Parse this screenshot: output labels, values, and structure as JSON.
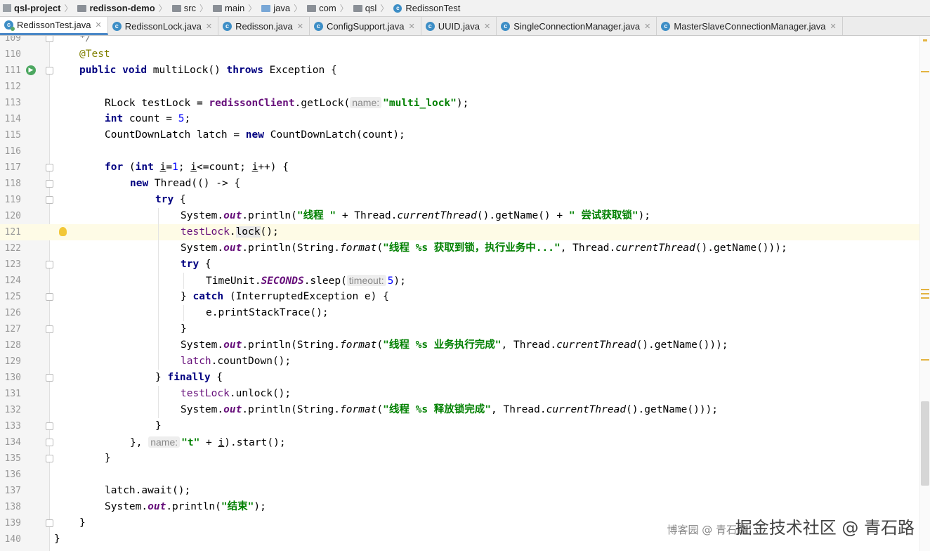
{
  "breadcrumb": {
    "items": [
      "qsl-project",
      "redisson-demo",
      "src",
      "main",
      "java",
      "com",
      "qsl",
      "RedissonTest"
    ]
  },
  "tabs": [
    {
      "label": "RedissonTest.java",
      "icon": "test-class-icon"
    },
    {
      "label": "RedissonLock.java",
      "icon": "class-icon"
    },
    {
      "label": "Redisson.java",
      "icon": "class-icon"
    },
    {
      "label": "ConfigSupport.java",
      "icon": "class-icon"
    },
    {
      "label": "UUID.java",
      "icon": "class-icon"
    },
    {
      "label": "SingleConnectionManager.java",
      "icon": "class-icon"
    },
    {
      "label": "MasterSlaveConnectionManager.java",
      "icon": "class-icon"
    }
  ],
  "editor": {
    "current_line": 121,
    "line_numbers": [
      "109",
      "110",
      "111",
      "112",
      "113",
      "114",
      "115",
      "116",
      "117",
      "118",
      "119",
      "120",
      "121",
      "122",
      "123",
      "124",
      "125",
      "126",
      "127",
      "128",
      "129",
      "130",
      "131",
      "132",
      "133",
      "134",
      "135",
      "136",
      "137",
      "138",
      "139",
      "140"
    ],
    "code": {
      "l109": "*/",
      "l110_annotation": "@Test",
      "l111": [
        "public",
        "void",
        " multiLock() ",
        "throws",
        " Exception {"
      ],
      "l113": [
        "RLock testLock = ",
        "redissonClient",
        ".getLock(",
        "name:",
        "\"multi_lock\"",
        ");"
      ],
      "l114": [
        "int",
        " count = ",
        "5",
        ";"
      ],
      "l115": [
        "CountDownLatch latch = ",
        "new",
        " CountDownLatch(count);"
      ],
      "l117": [
        "for",
        " (",
        "int",
        " ",
        "i",
        "=",
        "1",
        "; ",
        "i",
        "<=count; ",
        "i",
        "++) {"
      ],
      "l118": [
        "new",
        " Thread(() -> {"
      ],
      "l119": [
        "try",
        " {"
      ],
      "l120": [
        "System.",
        "out",
        ".println(",
        "\"线程 \"",
        " + Thread.",
        "currentThread",
        "().getName() + ",
        "\" 尝试获取锁\"",
        ");"
      ],
      "l121": [
        "testLock",
        ".",
        "lock",
        "();"
      ],
      "l122": [
        "System.",
        "out",
        ".println(String.",
        "format",
        "(",
        "\"线程 %s 获取到锁，执行业务中...\"",
        ", Thread.",
        "currentThread",
        "().getName()));"
      ],
      "l123": [
        "try",
        " {"
      ],
      "l124": [
        "TimeUnit.",
        "SECONDS",
        ".sleep(",
        "timeout:",
        "5",
        ");"
      ],
      "l125": [
        "} ",
        "catch",
        " (InterruptedException e) {"
      ],
      "l126": "e.printStackTrace();",
      "l127": "}",
      "l128": [
        "System.",
        "out",
        ".println(String.",
        "format",
        "(",
        "\"线程 %s 业务执行完成\"",
        ", Thread.",
        "currentThread",
        "().getName()));"
      ],
      "l129": [
        "latch",
        ".countDown();"
      ],
      "l130": [
        "} ",
        "finally",
        " {"
      ],
      "l131": [
        "testLock",
        ".unlock();"
      ],
      "l132": [
        "System.",
        "out",
        ".println(String.",
        "format",
        "(",
        "\"线程 %s 释放锁完成\"",
        ", Thread.",
        "currentThread",
        "().getName()));"
      ],
      "l133": "}",
      "l134": [
        "}, ",
        "name:",
        "\"t\"",
        " + ",
        "i",
        ").start();"
      ],
      "l135": "}",
      "l137": "latch.await();",
      "l138": [
        "System.",
        "out",
        ".println(",
        "\"结束\"",
        ");"
      ],
      "l139": "}",
      "l140": "}"
    }
  },
  "watermark": {
    "primary": "掘金技术社区 @ 青石路",
    "secondary": "博客园 @ 青石路"
  },
  "colors": {
    "keyword": "#000080",
    "string": "#008000",
    "number": "#0000ff",
    "annotation": "#808000",
    "field": "#660e7a",
    "current_line": "#fefbe6",
    "active_tab_underline": "#4a88c7"
  }
}
